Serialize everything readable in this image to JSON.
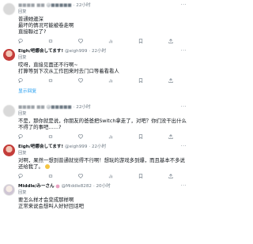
{
  "posts": [
    {
      "name": "",
      "handle": "",
      "time": "· 22小时",
      "reply_prefix": "回复",
      "reply_to": "",
      "reply_tag": "",
      "body": "普通她邊深\n最坏的情况可能被卷走啊\n直接聯过了?"
    },
    {
      "name": "Eigh/吧娜会してます!",
      "handle": "@eigh999",
      "time": "· 22小时",
      "reply_prefix": "回复",
      "reply_to": "",
      "reply_tag": "",
      "body": "哎呀，直接见面还不行啊~\n打算等到下次从工作回来时去门口等着看看人"
    },
    {
      "name": "",
      "handle": "",
      "time": "· 22小时",
      "reply_prefix": "回复",
      "reply_to": "",
      "reply_tag": "",
      "body": "不是，那你就是说，你朋友的爸爸把Switch拿走了，对吧？你们没干出什么不得了的事吧……?"
    },
    {
      "name": "Eigh/吧娜会してます!",
      "handle": "@eigh999",
      "time": "· 22小时",
      "reply_prefix": "回复",
      "reply_to": "",
      "reply_tag": "",
      "body": "对啊，果然一想到普通就觉得不行啊！想玩的游戏多到爆，而且基本不多说还给我了。"
    },
    {
      "name": "Middle/みーさん",
      "handle": "@Middle8282",
      "time": "· 20小时",
      "reply_prefix": "回复",
      "reply_to": "",
      "reply_tag": "",
      "body": "要怎么样才会变成那样啊\n正常来说会想叫人好好回话吧"
    }
  ],
  "show_replies": "显示回复",
  "more_icon": "···",
  "action_icons": [
    "reply-icon",
    "retweet-icon",
    "like-icon",
    "views-icon",
    "bookmark-icon",
    "share-icon"
  ]
}
